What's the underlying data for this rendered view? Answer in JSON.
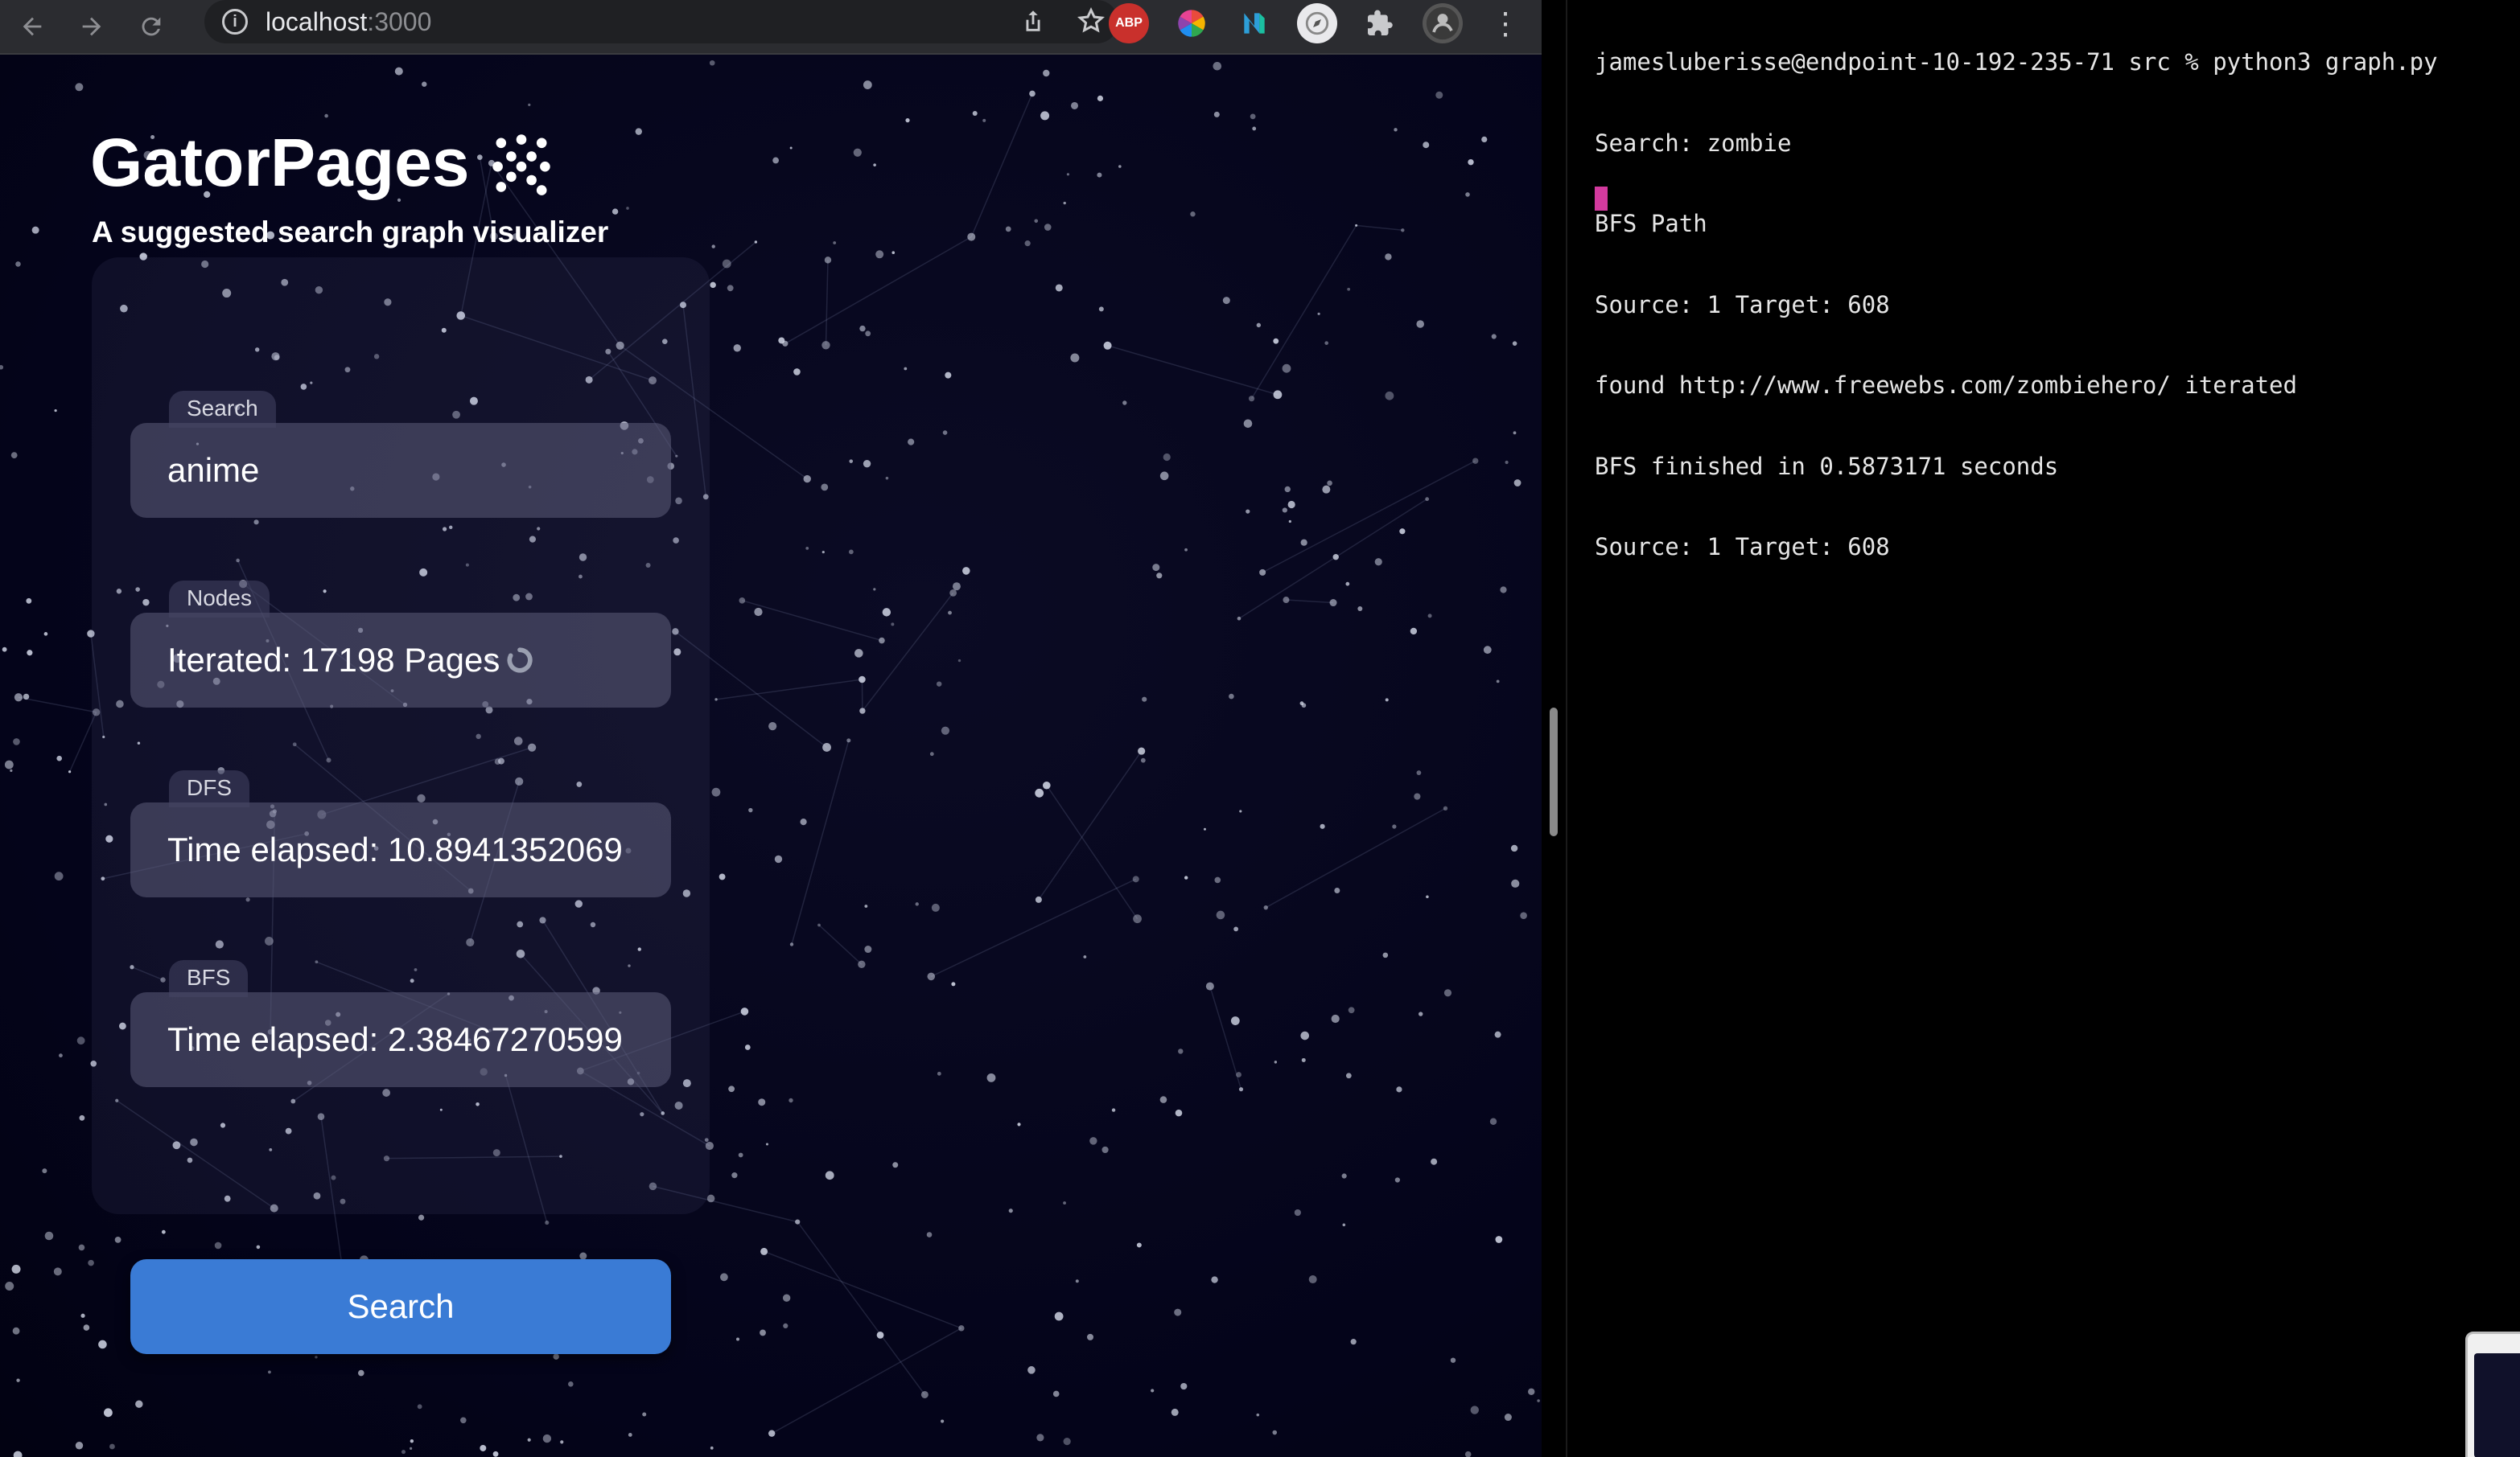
{
  "browser": {
    "url_host": "localhost",
    "url_port": ":3000",
    "extensions": [
      "adblock-icon",
      "color-wheel-icon",
      "n-logo-icon",
      "compass-icon",
      "puzzle-icon",
      "profile-avatar"
    ]
  },
  "app": {
    "title": "GatorPages",
    "subtitle": "A suggested search graph visualizer",
    "fields": [
      {
        "label": "Search",
        "value": "anime"
      },
      {
        "label": "Nodes",
        "value": "Iterated: 17198 Pages"
      },
      {
        "label": "DFS",
        "value": "Time elapsed: 10.8941352069"
      },
      {
        "label": "BFS",
        "value": "Time elapsed: 2.38467270599"
      }
    ],
    "search_button": "Search"
  },
  "terminal": {
    "lines": [
      "jamesluberisse@endpoint-10-192-235-71 src % python3 graph.py",
      "Search: zombie",
      "BFS Path",
      "Source: 1 Target: 608",
      "found http://www.freewebs.com/zombiehero/ iterated",
      "BFS finished in 0.5873171 seconds",
      "Source: 1 Target: 608"
    ]
  },
  "colors": {
    "page_bg": "#04041a",
    "accent_button": "#3a7bd5",
    "terminal_cursor": "#d33a9e"
  }
}
